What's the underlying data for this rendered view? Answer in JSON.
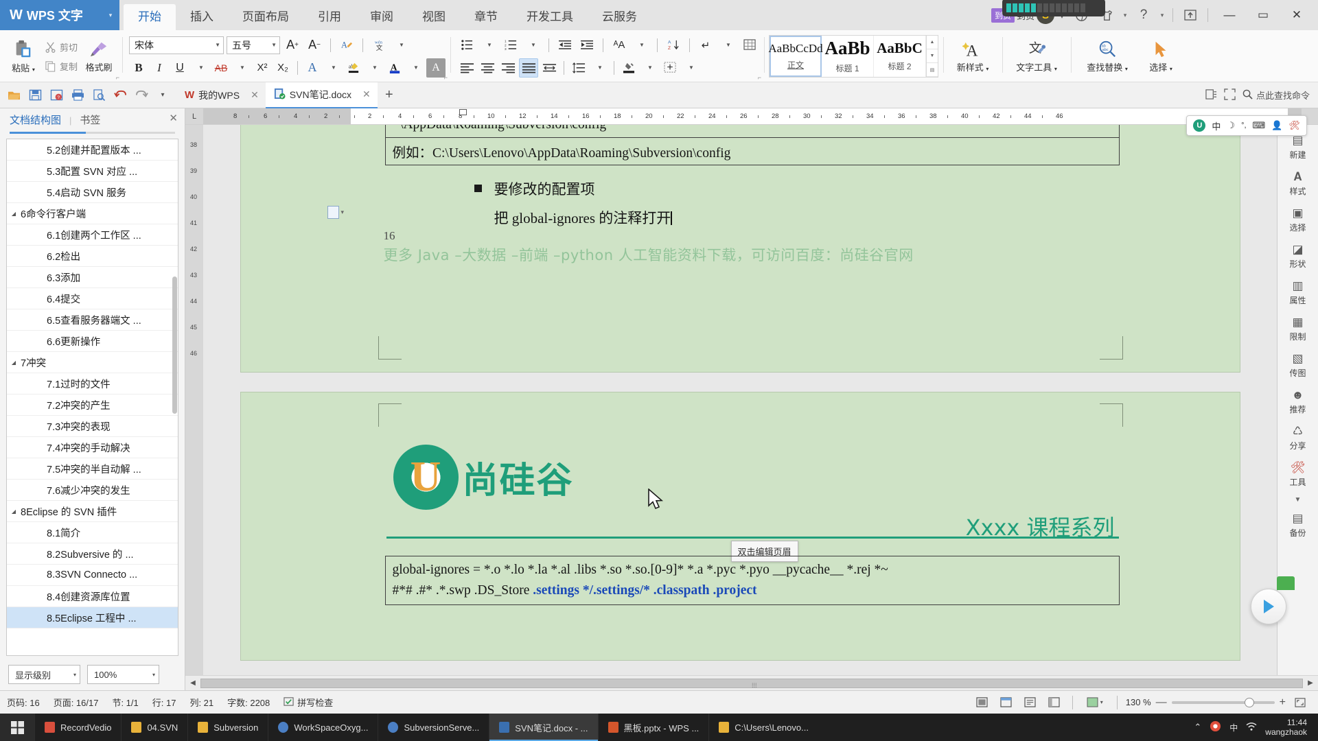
{
  "titlebar": {
    "app_name": "WPS 文字",
    "app_caret": "▾",
    "ribbon_tabs": [
      {
        "label": "开始",
        "active": true
      },
      {
        "label": "插入",
        "active": false
      },
      {
        "label": "页面布局",
        "active": false
      },
      {
        "label": "引用",
        "active": false
      },
      {
        "label": "审阅",
        "active": false
      },
      {
        "label": "视图",
        "active": false
      },
      {
        "label": "章节",
        "active": false
      },
      {
        "label": "开发工具",
        "active": false
      },
      {
        "label": "云服务",
        "active": false
      }
    ],
    "badge_left": "到货",
    "badge_right": "到货",
    "account_glyph": "S",
    "account_caret": "▾",
    "globe_icon": "globe-icon",
    "shirt_icon": "shirt-icon",
    "help_label": "?",
    "help_caret": "▾",
    "share_icon": "share-upload-icon",
    "minimize": "—",
    "maximize": "▭",
    "close": "✕"
  },
  "ribbon": {
    "paste": {
      "label": "粘贴",
      "caret": "▾"
    },
    "cut": {
      "label": "剪切"
    },
    "copy": {
      "label": "复制"
    },
    "format_painter": {
      "label": "格式刷"
    },
    "font_name": "宋体",
    "font_size": "五号",
    "grow_font": "A⁺",
    "shrink_font": "A⁻",
    "clear_format": "清除格式",
    "pinyin": "拼音指南",
    "bold": "B",
    "italic": "I",
    "underline": "U",
    "strikethrough": "AB",
    "superscript": "X²",
    "subscript": "X₂",
    "text_outline": "A",
    "highlight": "突出显示",
    "font_color": "A",
    "char_shading": "A",
    "bullets": "项目符号",
    "numbering": "编号",
    "decrease_indent": "减少缩进",
    "increase_indent": "增加缩进",
    "pinyin_guide": "拼音",
    "sort": "排序",
    "show_marks": "显示段落标记",
    "table_grid": "边框",
    "align_left": "左对齐",
    "align_center": "居中",
    "align_right": "右对齐",
    "align_justify": "两端对齐",
    "distribute": "分散对齐",
    "line_spacing": "行距",
    "shading": "底纹",
    "borders": "边框",
    "styles": [
      {
        "preview": "AaBbCcDd",
        "name": "正文",
        "selected": true
      },
      {
        "preview": "AaBb",
        "name": "标题 1",
        "selected": false
      },
      {
        "preview": "AaBbC",
        "name": "标题 2",
        "selected": false
      }
    ],
    "new_style": {
      "label": "新样式",
      "caret": "▾"
    },
    "text_tools": {
      "label": "文字工具",
      "caret": "▾"
    },
    "find_replace": {
      "label": "查找替换",
      "caret": "▾"
    },
    "select": {
      "label": "选择",
      "caret": "▾"
    }
  },
  "quickaccess": {
    "icons": [
      "open-folder-icon",
      "save-icon",
      "save-as-icon",
      "print-icon",
      "print-preview-icon",
      "undo-icon",
      "redo-icon"
    ],
    "overflow_caret": "▾",
    "doc_tabs": [
      {
        "label": "我的WPS",
        "icon": "wps-cloud-icon",
        "active": false,
        "close": "✕"
      },
      {
        "label": "SVN笔记.docx",
        "icon": "docx-icon",
        "active": true,
        "close": "✕"
      }
    ],
    "add_tab": "+",
    "right_icons": [
      "backstage-icon",
      "fullscreen-icon"
    ],
    "search_label": "点此查找命令",
    "search_icon": "search-icon"
  },
  "navpanel": {
    "tab_outline": "文档结构图",
    "tab_bookmark": "书签",
    "divider": "|",
    "close": "✕",
    "items": [
      {
        "label": "5.2创建并配置版本 ...",
        "level": 2,
        "selected": false,
        "expander": ""
      },
      {
        "label": "5.3配置 SVN 对应 ...",
        "level": 2,
        "selected": false,
        "expander": ""
      },
      {
        "label": "5.4启动 SVN 服务",
        "level": 2,
        "selected": false,
        "expander": ""
      },
      {
        "label": "6命令行客户端",
        "level": 1,
        "selected": false,
        "expander": "◢"
      },
      {
        "label": "6.1创建两个工作区 ...",
        "level": 2,
        "selected": false,
        "expander": ""
      },
      {
        "label": "6.2检出",
        "level": 2,
        "selected": false,
        "expander": ""
      },
      {
        "label": "6.3添加",
        "level": 2,
        "selected": false,
        "expander": ""
      },
      {
        "label": "6.4提交",
        "level": 2,
        "selected": false,
        "expander": ""
      },
      {
        "label": "6.5查看服务器端文 ...",
        "level": 2,
        "selected": false,
        "expander": ""
      },
      {
        "label": "6.6更新操作",
        "level": 2,
        "selected": false,
        "expander": ""
      },
      {
        "label": "7冲突",
        "level": 1,
        "selected": false,
        "expander": "◢"
      },
      {
        "label": "7.1过时的文件",
        "level": 2,
        "selected": false,
        "expander": ""
      },
      {
        "label": "7.2冲突的产生",
        "level": 2,
        "selected": false,
        "expander": ""
      },
      {
        "label": "7.3冲突的表现",
        "level": 2,
        "selected": false,
        "expander": ""
      },
      {
        "label": "7.4冲突的手动解决",
        "level": 2,
        "selected": false,
        "expander": ""
      },
      {
        "label": "7.5冲突的半自动解 ...",
        "level": 2,
        "selected": false,
        "expander": ""
      },
      {
        "label": "7.6减少冲突的发生",
        "level": 2,
        "selected": false,
        "expander": ""
      },
      {
        "label": "8Eclipse 的 SVN 插件",
        "level": 1,
        "selected": false,
        "expander": "◢"
      },
      {
        "label": "8.1简介",
        "level": 2,
        "selected": false,
        "expander": ""
      },
      {
        "label": "8.2Subversive 的 ...",
        "level": 2,
        "selected": false,
        "expander": ""
      },
      {
        "label": "8.3SVN Connecto ...",
        "level": 2,
        "selected": false,
        "expander": ""
      },
      {
        "label": "8.4创建资源库位置",
        "level": 2,
        "selected": false,
        "expander": ""
      },
      {
        "label": "8.5Eclipse 工程中 ...",
        "level": 2,
        "selected": true,
        "expander": ""
      }
    ],
    "display_level": {
      "label": "显示级别",
      "caret": "▾"
    },
    "zoom_value": {
      "label": "100%",
      "caret": "▾"
    }
  },
  "ruler": {
    "corner_mark": "L",
    "left_numbers": [
      "8",
      "6",
      "4",
      "2"
    ],
    "right_numbers": [
      "2",
      "4",
      "6",
      "8",
      "10",
      "12",
      "14",
      "16",
      "18",
      "20",
      "22",
      "24",
      "26",
      "28",
      "30",
      "32",
      "34",
      "36",
      "38",
      "40",
      "42",
      "44",
      "46"
    ],
    "vertical_numbers": [
      "38",
      "39",
      "40",
      "41",
      "42",
      "43",
      "44",
      "45",
      "46"
    ]
  },
  "document": {
    "page1": {
      "line_partial": "~\\AppData\\Roaming\\Subversion\\config",
      "boxed_line": "例如：C:\\Users\\Lenovo\\AppData\\Roaming\\Subversion\\config",
      "bullet_title": "要修改的配置项",
      "bullet_body": "把 global-ignores 的注释打开",
      "page_number": "16",
      "footer_promo": "更多 Java –大数据 –前端 –python 人工智能资料下载，可访问百度：尚硅谷官网"
    },
    "page2": {
      "logo_letter": "U",
      "logo_text": "尚硅谷",
      "course_title": "Xxxx 课程系列",
      "header_tooltip": "双击编辑页眉",
      "code_line1_plain": "global-ignores = *.o *.lo *.la *.al .libs *.so *.so.[0-9]* *.a *.pyc *.pyo __pycache__  *.rej *~",
      "code_line2_plain": "#*# .#* .*.swp .DS_Store ",
      "code_line2_highlight": ".settings */.settings/* .classpath .project"
    }
  },
  "taskpane": {
    "items": [
      {
        "label": "新建",
        "icon": "new-doc-icon"
      },
      {
        "label": "样式",
        "icon": "styles-icon"
      },
      {
        "label": "选择",
        "icon": "select-pane-icon"
      },
      {
        "label": "形状",
        "icon": "shapes-icon"
      },
      {
        "label": "属性",
        "icon": "properties-icon"
      },
      {
        "label": "限制",
        "icon": "restrict-icon"
      },
      {
        "label": "传图",
        "icon": "upload-image-icon"
      },
      {
        "label": "推荐",
        "icon": "recommend-icon"
      },
      {
        "label": "分享",
        "icon": "share-icon"
      },
      {
        "label": "工具",
        "icon": "tools-icon"
      },
      {
        "label": "备份",
        "icon": "backup-icon"
      }
    ],
    "scroll_up": "▲",
    "scroll_down": "▼"
  },
  "ime": {
    "logo": "U",
    "mode": "中",
    "icons": [
      "moon-icon",
      "emoji-icon",
      "keyboard-icon",
      "user-icon",
      "tools-icon"
    ]
  },
  "statusbar": {
    "page_label": "页码: 16",
    "pages_label": "页面: 16/17",
    "section_label": "节: 1/1",
    "rows_label": "行: 17",
    "cols_label": "列: 21",
    "words_label": "字数: 2208",
    "spellcheck_label": "拼写检查",
    "view_icons": [
      "page-layout-view",
      "full-screen-view",
      "outline-view",
      "web-layout-view",
      "reading-view"
    ],
    "page_color_label": "页面颜色",
    "zoom_percent": "130 %",
    "zoom_out": "—",
    "zoom_in": "+",
    "fit_icon": "fit-page-icon"
  },
  "taskbar": {
    "start_icon": "windows-start-icon",
    "apps": [
      {
        "label": "RecordVedio",
        "color": "#d94f3d",
        "active": false
      },
      {
        "label": "04.SVN",
        "color": "#e8b23a",
        "active": false
      },
      {
        "label": "Subversion",
        "color": "#e8b23a",
        "active": false
      },
      {
        "label": "WorkSpaceOxyg...",
        "color": "#4b7fc4",
        "active": false
      },
      {
        "label": "SubversionServe...",
        "color": "#4b7fc4",
        "active": false
      },
      {
        "label": "SVN笔记.docx - ...",
        "color": "#3a6fb0",
        "active": true
      },
      {
        "label": "黑板.pptx - WPS ...",
        "color": "#d4562c",
        "active": false
      },
      {
        "label": "C:\\Users\\Lenovo...",
        "color": "#e8b23a",
        "active": false
      }
    ],
    "tray_caret": "⌃",
    "tray_icons": [
      "browser-icon",
      "ime-icon",
      "network-icon",
      "volume-icon"
    ],
    "ime_label": "中",
    "clock_time": "11:44",
    "clock_date": "wangzhaok"
  },
  "colors": {
    "accent": "#4a90d9",
    "titlebar_logo": "#4285c8",
    "page_bg": "#cfe3c6",
    "brand_green": "#1f9e7a",
    "brand_orange": "#e8a33d",
    "keyword_blue": "#1a49b8"
  }
}
